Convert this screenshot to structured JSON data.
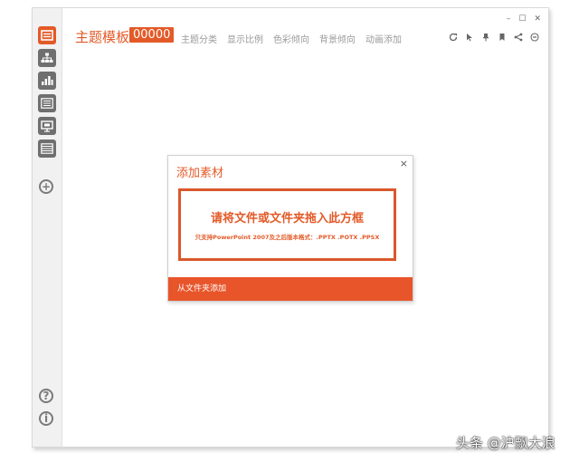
{
  "app": {
    "title": "主题模板",
    "badge": "00000",
    "tabs": [
      "主题分类",
      "显示比例",
      "色彩倾向",
      "背景倾向",
      "动画添加"
    ]
  },
  "window_controls": {
    "minimize": "–",
    "maximize": "☐",
    "close": "✕"
  },
  "sidebar": {
    "items": [
      "template-icon",
      "hierarchy-icon",
      "chart-icon",
      "list-icon",
      "presentation-icon",
      "table-icon"
    ],
    "add": "+",
    "help": "?",
    "info": "i"
  },
  "dialog": {
    "title": "添加素材",
    "close": "×",
    "drop_main": "请将文件或文件夹拖入此方框",
    "drop_sub": "只支持PowerPoint 2007及之后版本格式：.PPTX .POTX .PPSX",
    "footer": "从文件夹添加"
  },
  "watermark": "头条 @沪飘大浪",
  "colors": {
    "accent": "#e35a28",
    "footer": "#e8552a"
  }
}
